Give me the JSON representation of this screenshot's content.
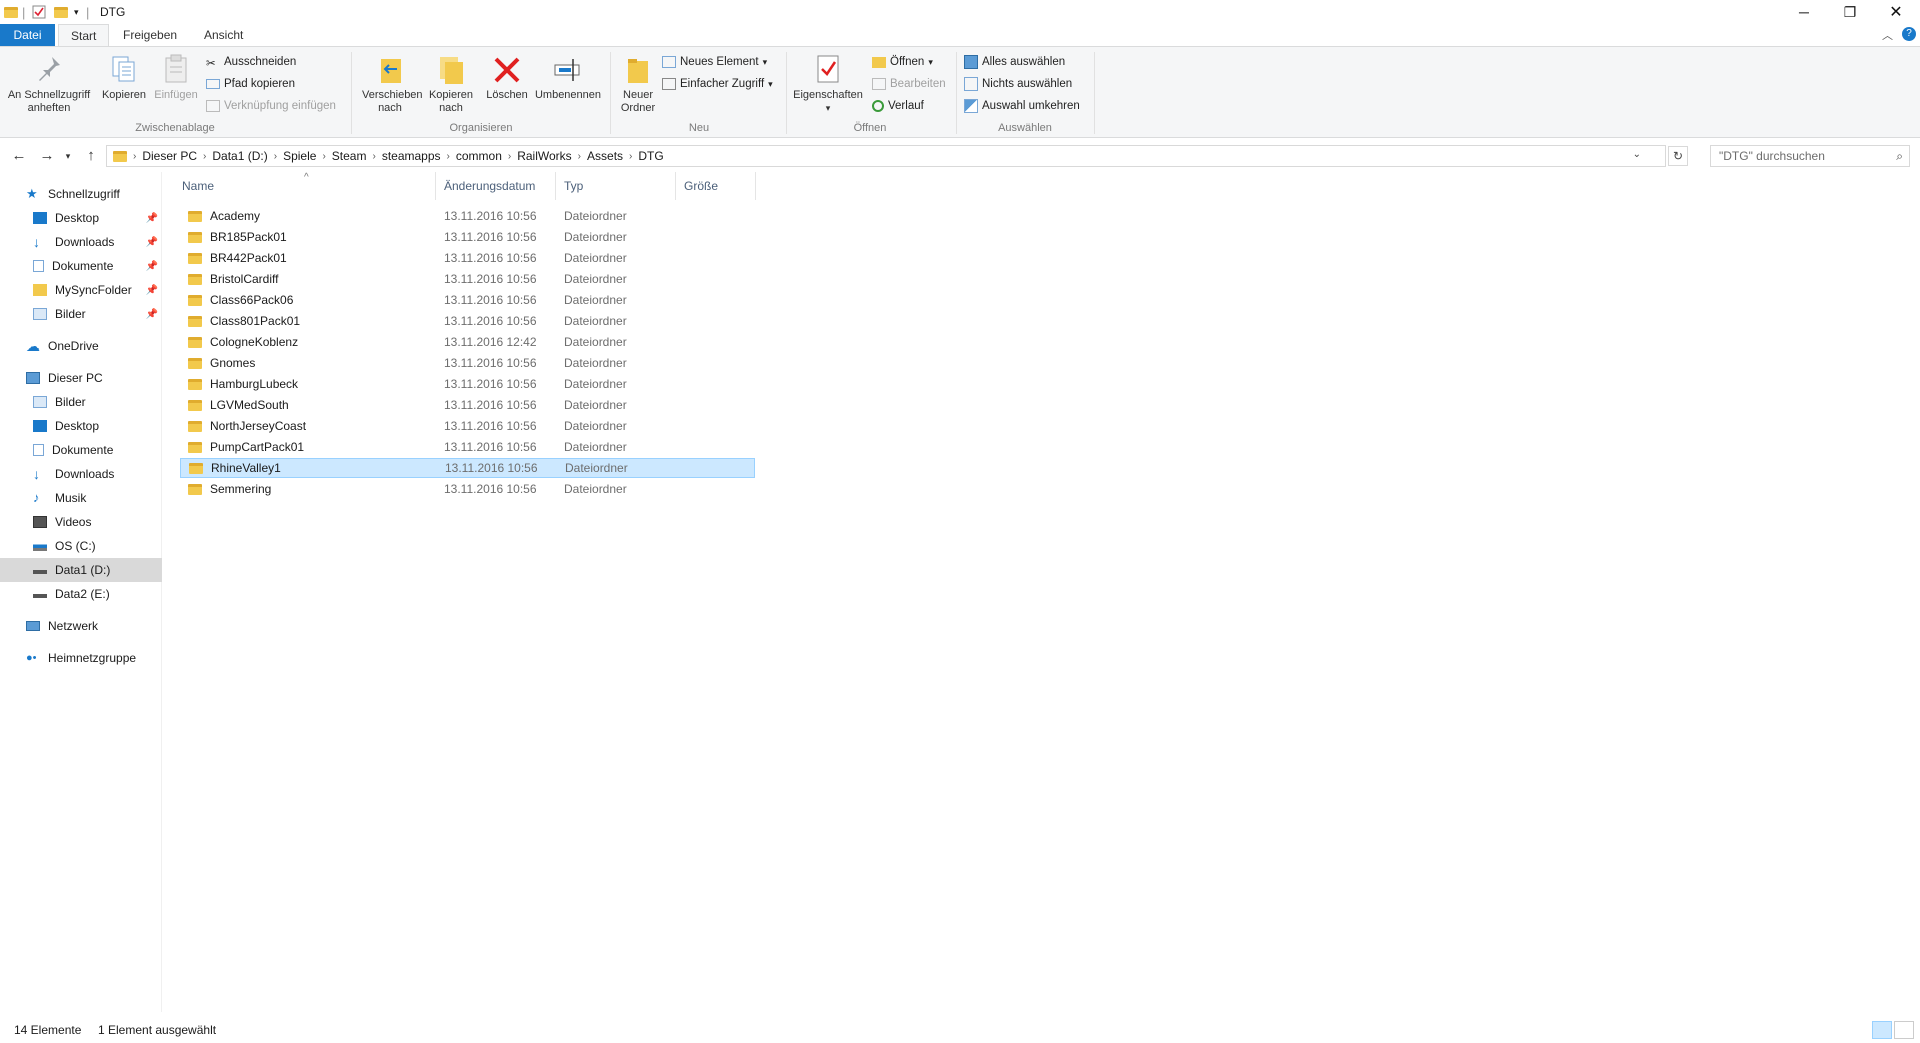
{
  "window": {
    "title": "DTG"
  },
  "tabs": [
    {
      "label": "Datei"
    },
    {
      "label": "Start"
    },
    {
      "label": "Freigeben"
    },
    {
      "label": "Ansicht"
    }
  ],
  "ribbon": {
    "pin_quick_access": "An Schnellzugriff anheften",
    "copy": "Kopieren",
    "paste": "Einfügen",
    "cut": "Ausschneiden",
    "copy_path": "Pfad kopieren",
    "paste_shortcut": "Verknüpfung einfügen",
    "group_clipboard": "Zwischenablage",
    "move_to": "Verschieben nach",
    "copy_to": "Kopieren nach",
    "delete": "Löschen",
    "rename": "Umbenennen",
    "group_organize": "Organisieren",
    "new_folder": "Neuer Ordner",
    "new_item": "Neues Element",
    "easy_access": "Einfacher Zugriff",
    "group_new": "Neu",
    "properties": "Eigenschaften",
    "open": "Öffnen",
    "edit": "Bearbeiten",
    "history": "Verlauf",
    "group_open": "Öffnen",
    "select_all": "Alles auswählen",
    "select_none": "Nichts auswählen",
    "invert_selection": "Auswahl umkehren",
    "group_select": "Auswählen"
  },
  "address": {
    "crumbs": [
      "Dieser PC",
      "Data1 (D:)",
      "Spiele",
      "Steam",
      "steamapps",
      "common",
      "RailWorks",
      "Assets",
      "DTG"
    ],
    "search_placeholder": "\"DTG\" durchsuchen"
  },
  "navpane": {
    "items": [
      {
        "label": "Schnellzugriff"
      },
      {
        "label": "Desktop"
      },
      {
        "label": "Downloads"
      },
      {
        "label": "Dokumente"
      },
      {
        "label": "MySyncFolder"
      },
      {
        "label": "Bilder"
      },
      {
        "label": "OneDrive"
      },
      {
        "label": "Dieser PC"
      },
      {
        "label": "Bilder"
      },
      {
        "label": "Desktop"
      },
      {
        "label": "Dokumente"
      },
      {
        "label": "Downloads"
      },
      {
        "label": "Musik"
      },
      {
        "label": "Videos"
      },
      {
        "label": "OS (C:)"
      },
      {
        "label": "Data1 (D:)"
      },
      {
        "label": "Data2 (E:)"
      },
      {
        "label": "Netzwerk"
      },
      {
        "label": "Heimnetzgruppe"
      }
    ]
  },
  "columns": {
    "name": "Name",
    "date": "Änderungsdatum",
    "type": "Typ",
    "size": "Größe"
  },
  "files": [
    {
      "name": "Academy",
      "date": "13.11.2016 10:56",
      "type": "Dateiordner"
    },
    {
      "name": "BR185Pack01",
      "date": "13.11.2016 10:56",
      "type": "Dateiordner"
    },
    {
      "name": "BR442Pack01",
      "date": "13.11.2016 10:56",
      "type": "Dateiordner"
    },
    {
      "name": "BristolCardiff",
      "date": "13.11.2016 10:56",
      "type": "Dateiordner"
    },
    {
      "name": "Class66Pack06",
      "date": "13.11.2016 10:56",
      "type": "Dateiordner"
    },
    {
      "name": "Class801Pack01",
      "date": "13.11.2016 10:56",
      "type": "Dateiordner"
    },
    {
      "name": "CologneKoblenz",
      "date": "13.11.2016 12:42",
      "type": "Dateiordner"
    },
    {
      "name": "Gnomes",
      "date": "13.11.2016 10:56",
      "type": "Dateiordner"
    },
    {
      "name": "HamburgLubeck",
      "date": "13.11.2016 10:56",
      "type": "Dateiordner"
    },
    {
      "name": "LGVMedSouth",
      "date": "13.11.2016 10:56",
      "type": "Dateiordner"
    },
    {
      "name": "NorthJerseyCoast",
      "date": "13.11.2016 10:56",
      "type": "Dateiordner"
    },
    {
      "name": "PumpCartPack01",
      "date": "13.11.2016 10:56",
      "type": "Dateiordner"
    },
    {
      "name": "RhineValley1",
      "date": "13.11.2016 10:56",
      "type": "Dateiordner"
    },
    {
      "name": "Semmering",
      "date": "13.11.2016 10:56",
      "type": "Dateiordner"
    }
  ],
  "status": {
    "count": "14 Elemente",
    "selected": "1 Element ausgewählt"
  }
}
